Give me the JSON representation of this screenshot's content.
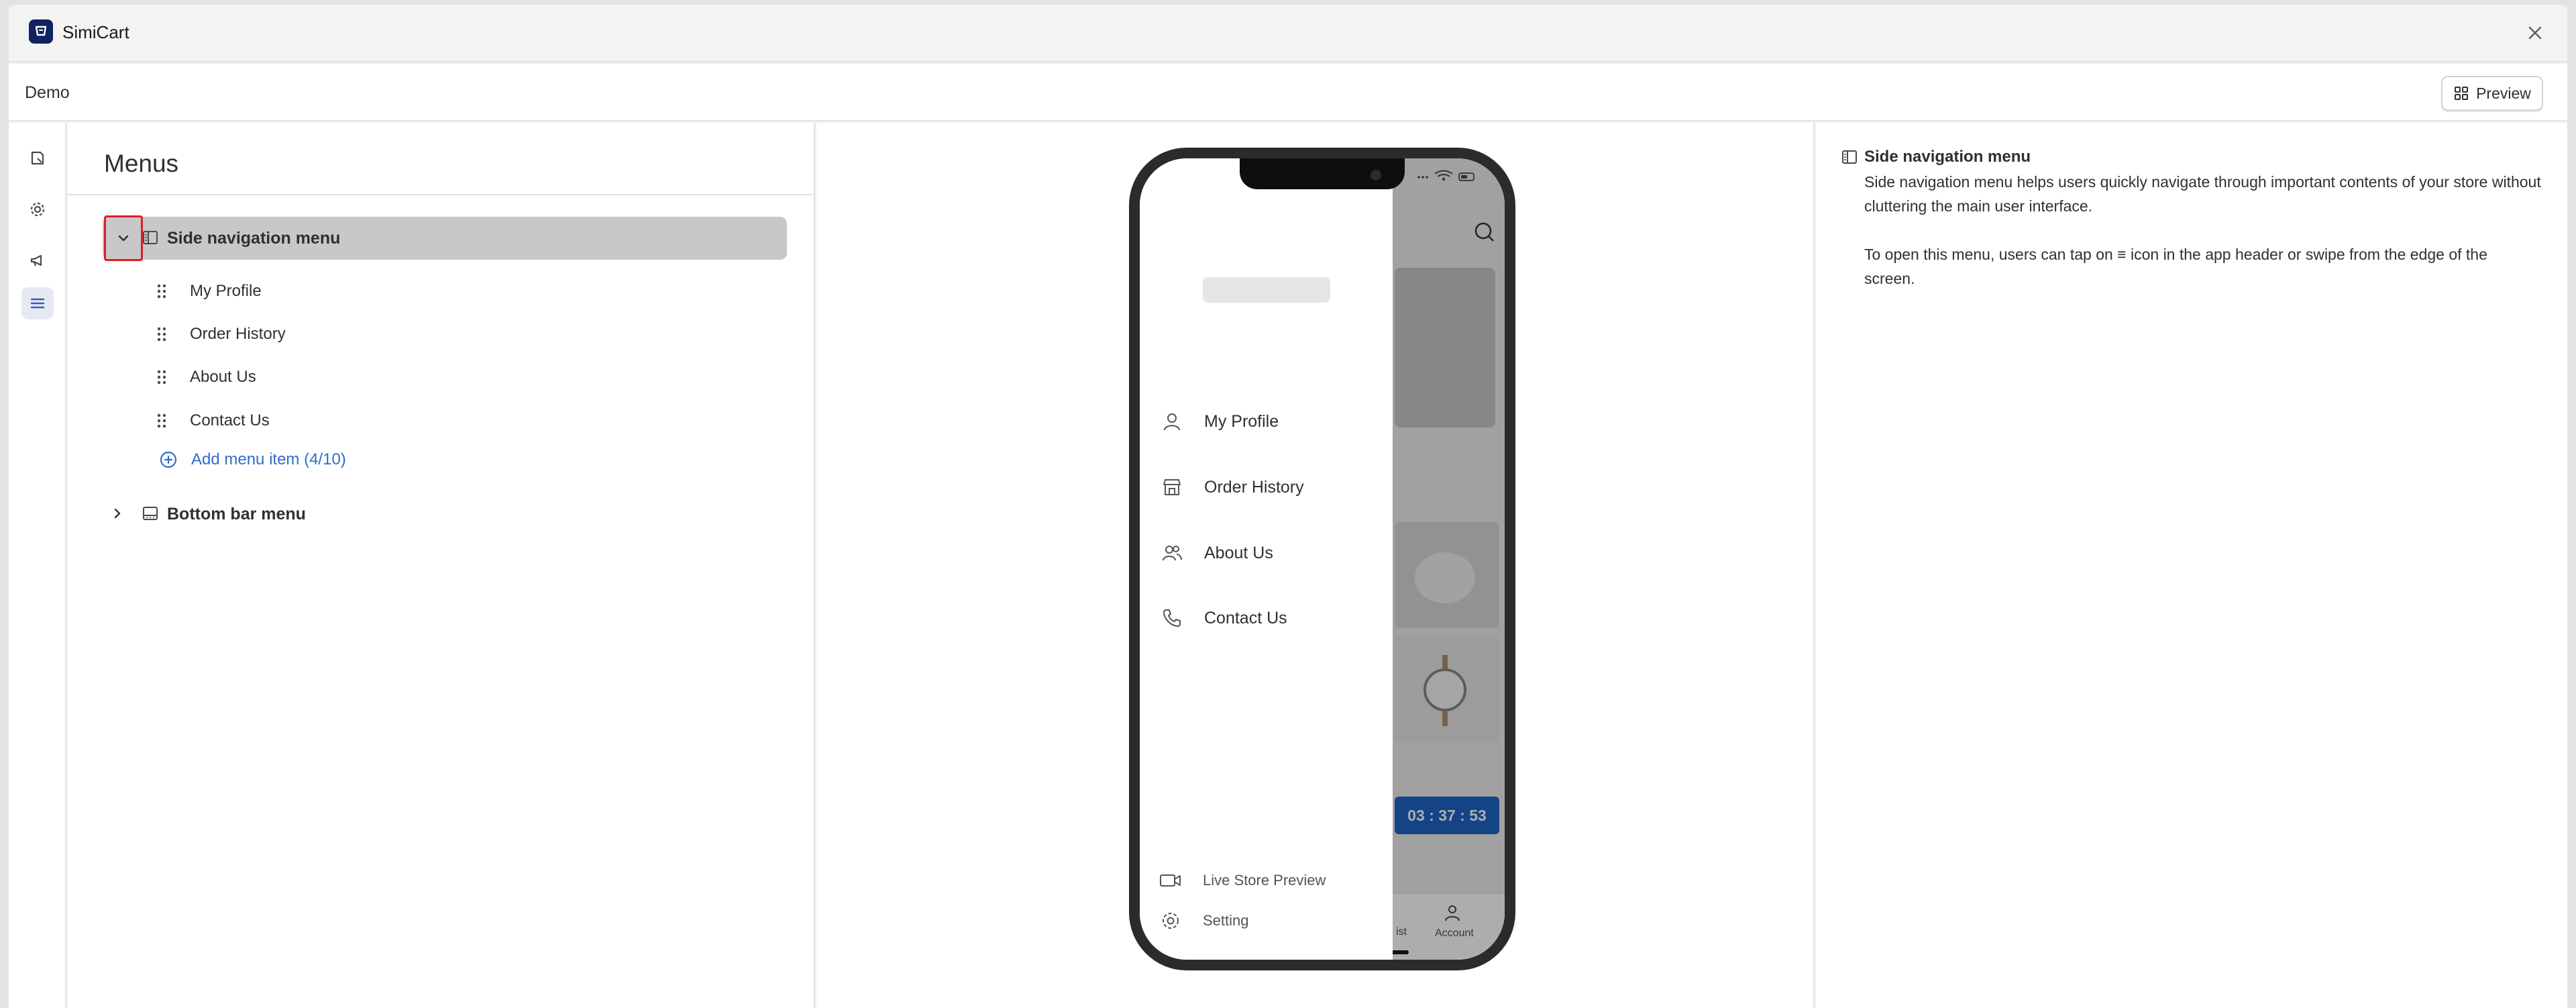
{
  "window": {
    "app_title": "SimiCart",
    "close_icon": "close-icon"
  },
  "header": {
    "store_name": "Demo",
    "preview_label": "Preview"
  },
  "leftbar": {
    "items": [
      {
        "icon": "layout-icon",
        "active": false
      },
      {
        "icon": "gear-icon",
        "active": false
      },
      {
        "icon": "megaphone-icon",
        "active": false
      },
      {
        "icon": "menu-lines-icon",
        "active": true
      }
    ]
  },
  "menus": {
    "title": "Menus",
    "groups": [
      {
        "label": "Side navigation menu",
        "expanded": true,
        "items": [
          {
            "label": "My Profile"
          },
          {
            "label": "Order History"
          },
          {
            "label": "About Us"
          },
          {
            "label": "Contact Us"
          }
        ],
        "add_label": "Add menu item (4/10)"
      },
      {
        "label": "Bottom bar menu",
        "expanded": false
      }
    ]
  },
  "phone": {
    "drawer_items": [
      {
        "label": "My Profile",
        "icon": "person-icon"
      },
      {
        "label": "Order History",
        "icon": "store-icon"
      },
      {
        "label": "About Us",
        "icon": "people-icon"
      },
      {
        "label": "Contact Us",
        "icon": "phone-icon"
      }
    ],
    "drawer_bottom": [
      {
        "label": "Live Store Preview",
        "icon": "video-icon"
      },
      {
        "label": "Setting",
        "icon": "gear-icon"
      }
    ],
    "countdown": "03 : 37 : 53",
    "tab_account": "Account",
    "tab_partial": "ist"
  },
  "info": {
    "title": "Side navigation menu",
    "paragraph1": "Side navigation menu helps users quickly navigate through important contents of your store without cluttering the main user interface.",
    "paragraph2": "To open this menu, users can tap on ≡ icon in the app header or swipe from the edge of the screen."
  }
}
